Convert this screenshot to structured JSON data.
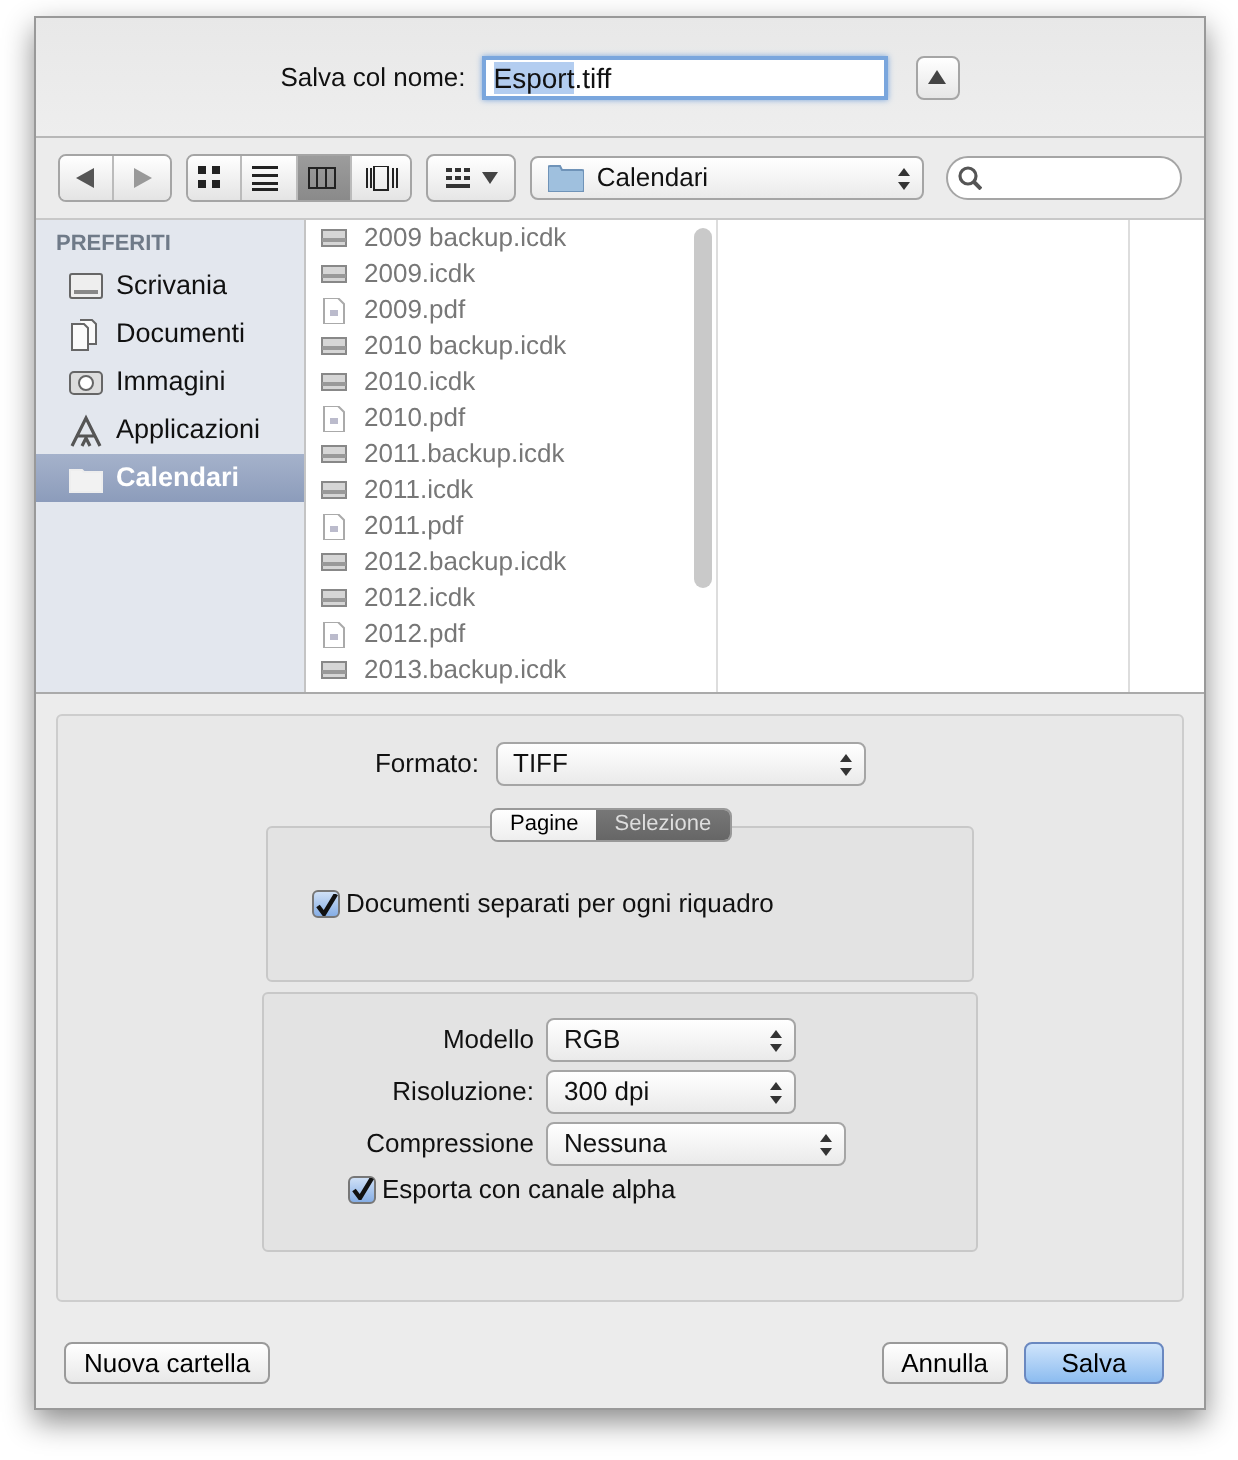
{
  "save_as": {
    "label": "Salva col nome:",
    "selected_text": "Esport",
    "rest_text": ".tiff"
  },
  "views": [
    {
      "kind": "icons",
      "selected": false
    },
    {
      "kind": "list",
      "selected": false
    },
    {
      "kind": "columns",
      "selected": true
    },
    {
      "kind": "coverflow",
      "selected": false
    }
  ],
  "location": {
    "value": "Calendari"
  },
  "sidebar": {
    "heading": "PREFERITI",
    "items": [
      {
        "label": "Scrivania",
        "kind": "desktop",
        "selected": false
      },
      {
        "label": "Documenti",
        "kind": "documents",
        "selected": false
      },
      {
        "label": "Immagini",
        "kind": "camera",
        "selected": false
      },
      {
        "label": "Applicazioni",
        "kind": "apps",
        "selected": false
      },
      {
        "label": "Calendari",
        "kind": "folder",
        "selected": true
      }
    ]
  },
  "files": [
    {
      "name": "2009 backup.icdk",
      "kind": "calendar"
    },
    {
      "name": "2009.icdk",
      "kind": "calendar"
    },
    {
      "name": "2009.pdf",
      "kind": "pdf"
    },
    {
      "name": "2010 backup.icdk",
      "kind": "calendar"
    },
    {
      "name": "2010.icdk",
      "kind": "calendar"
    },
    {
      "name": "2010.pdf",
      "kind": "pdf"
    },
    {
      "name": "2011.backup.icdk",
      "kind": "calendar"
    },
    {
      "name": "2011.icdk",
      "kind": "calendar"
    },
    {
      "name": "2011.pdf",
      "kind": "pdf"
    },
    {
      "name": "2012.backup.icdk",
      "kind": "calendar"
    },
    {
      "name": "2012.icdk",
      "kind": "calendar"
    },
    {
      "name": "2012.pdf",
      "kind": "pdf"
    },
    {
      "name": "2013.backup.icdk",
      "kind": "calendar"
    }
  ],
  "format": {
    "label": "Formato:",
    "value": "TIFF"
  },
  "tabs": [
    {
      "label": "Pagine",
      "selected": false
    },
    {
      "label": "Selezione",
      "selected": true
    }
  ],
  "separate_docs": {
    "label": "Documenti separati per ogni riquadro",
    "checked": true
  },
  "settings": [
    {
      "label": "Modello",
      "value": "RGB"
    },
    {
      "label": "Risoluzione:",
      "value": "300 dpi"
    },
    {
      "label": "Compressione",
      "value": "Nessuna"
    }
  ],
  "alpha": {
    "label": "Esporta con canale alpha",
    "checked": true
  },
  "buttons": {
    "new_folder": "Nuova cartella",
    "cancel": "Annulla",
    "save": "Salva"
  }
}
